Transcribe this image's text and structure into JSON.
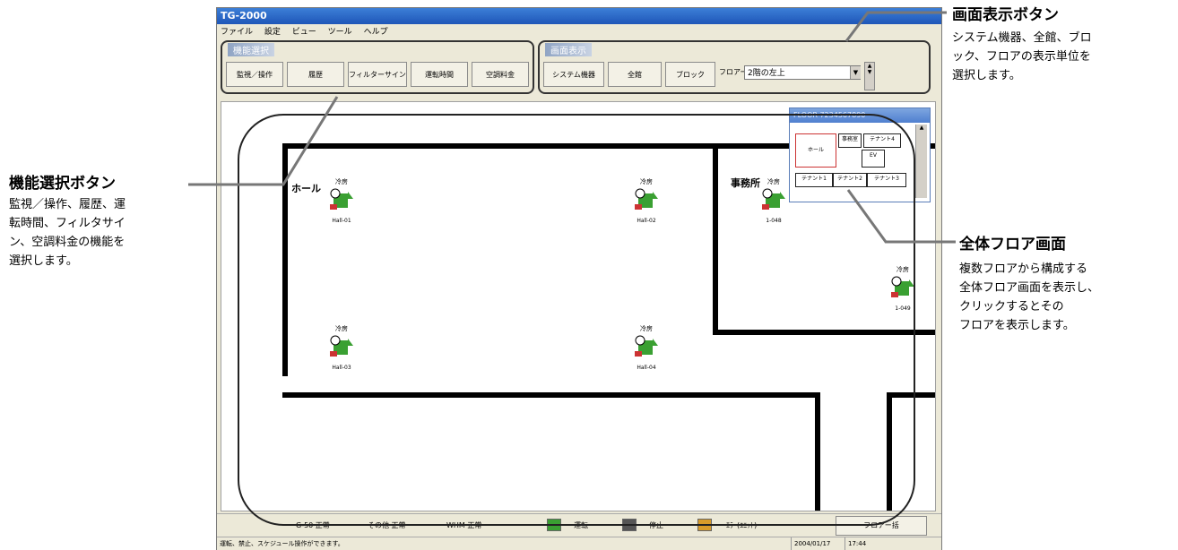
{
  "window": {
    "title": "TG-2000",
    "menu": [
      "ファイル",
      "設定",
      "ビュー",
      "ツール",
      "ヘルプ"
    ]
  },
  "function_group": {
    "title": "機能選択",
    "buttons": [
      "監視／操作",
      "履歴",
      "フィルターサイン",
      "運転時間",
      "空調料金"
    ]
  },
  "display_group": {
    "title": "画面表示",
    "buttons": [
      "システム機器",
      "全館",
      "ブロック"
    ],
    "floor_label": "フロアー",
    "floor_value": "2階の左上"
  },
  "map": {
    "rooms": [
      "ホール",
      "事務所"
    ],
    "units": [
      {
        "mode": "冷房",
        "name": "Hall-01"
      },
      {
        "mode": "冷房",
        "name": "Hall-02"
      },
      {
        "mode": "冷房",
        "name": "1-048"
      },
      {
        "mode": "冷房",
        "name": "1-049"
      },
      {
        "mode": "冷房",
        "name": "Hall-03"
      },
      {
        "mode": "冷房",
        "name": "Hall-04"
      }
    ]
  },
  "overview": {
    "title": "FLOOR 7234567890",
    "cells": [
      "ホール",
      "事務室",
      "テナント4",
      "EV",
      "テナント1",
      "テナント2",
      "テナント3"
    ]
  },
  "status": {
    "items": [
      "G-50 正常",
      "その他 正常",
      "WHM 正常"
    ],
    "legend": [
      "運転",
      "停止",
      "ｴﾗｰ(ﾕﾆｯﾄ)"
    ],
    "floor_all": "フロアー括",
    "message": "運転、禁止、スケジュール操作ができます。",
    "date": "2004/01/17",
    "time": "17:44"
  },
  "annotations": {
    "display": {
      "title": "画面表示ボタン",
      "desc": [
        "システム機器、全館、ブロ",
        "ック、フロアの表示単位を",
        "選択します。"
      ]
    },
    "function": {
      "title": "機能選択ボタン",
      "desc": [
        "監視／操作、履歴、運",
        "転時間、フィルタサイ",
        "ン、空調料金の機能を",
        "選択します。"
      ]
    },
    "floor": {
      "title": "全体フロア画面",
      "desc": [
        "複数フロアから構成する",
        "全体フロア画面を表示し、",
        "クリックするとその",
        "フロアを表示します。"
      ]
    }
  },
  "colors": {
    "titlebar": "#1f56b8",
    "unit_green": "#3aa032",
    "wall": "#000000"
  }
}
